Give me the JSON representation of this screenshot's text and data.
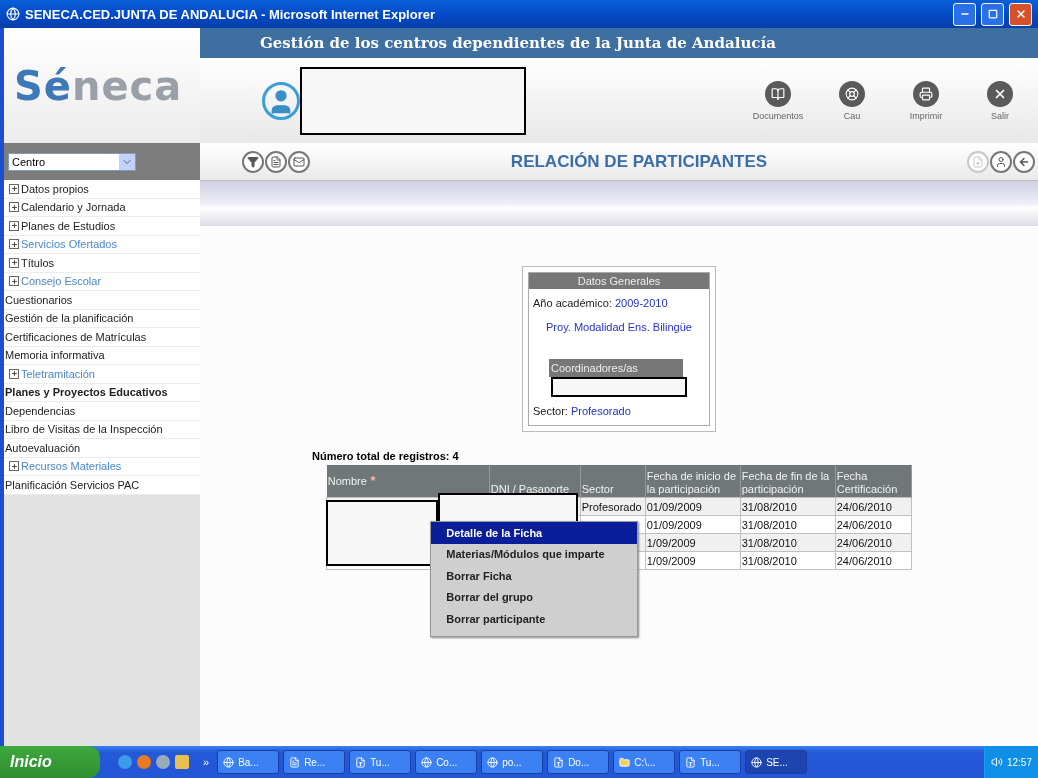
{
  "window": {
    "title": "SENECA.CED.JUNTA DE ANDALUCIA - Microsoft Internet Explorer"
  },
  "header": {
    "logo": "Séneca",
    "banner": "Gestión de los centros dependientes de la Junta de Andalucía",
    "actions": [
      {
        "kind": "docs",
        "label": "Documentos"
      },
      {
        "kind": "help",
        "label": "Cau"
      },
      {
        "kind": "print",
        "label": "Imprimir"
      },
      {
        "kind": "exit",
        "label": "Salir"
      }
    ]
  },
  "sidebar": {
    "select": "Centro",
    "items": [
      {
        "kind": "group",
        "label": "Datos propios",
        "highlighted": false
      },
      {
        "kind": "group",
        "label": "Calendario y Jornada",
        "highlighted": false
      },
      {
        "kind": "group",
        "label": "Planes de Estudios",
        "highlighted": false
      },
      {
        "kind": "group",
        "label": "Servicios Ofertados",
        "highlighted": true
      },
      {
        "kind": "group",
        "label": "Títulos",
        "highlighted": false
      },
      {
        "kind": "group",
        "label": "Consejo Escolar",
        "highlighted": true
      },
      {
        "kind": "item",
        "label": "Cuestionarios",
        "highlighted": false
      },
      {
        "kind": "item",
        "label": "Gestión de la planificación",
        "highlighted": false
      },
      {
        "kind": "item",
        "label": "Certificaciones de Matrículas",
        "highlighted": false
      },
      {
        "kind": "item",
        "label": "Memoria informativa",
        "highlighted": false
      },
      {
        "kind": "group",
        "label": "Teletramitación",
        "highlighted": true
      },
      {
        "kind": "heading",
        "label": "Planes y Proyectos Educativos",
        "highlighted": false
      },
      {
        "kind": "item",
        "label": "Dependencias",
        "highlighted": false
      },
      {
        "kind": "item",
        "label": "Libro de Visitas de la Inspección",
        "highlighted": false
      },
      {
        "kind": "item",
        "label": "Autoevaluación",
        "highlighted": false
      },
      {
        "kind": "group",
        "label": "Recursos Materiales",
        "highlighted": true
      },
      {
        "kind": "item",
        "label": "Planificación Servicios PAC",
        "highlighted": false
      }
    ]
  },
  "page": {
    "title": "RELACIÓN DE PARTICIPANTES",
    "tools_left": [
      {
        "kind": "filter"
      },
      {
        "kind": "export"
      },
      {
        "kind": "mail"
      }
    ],
    "tools_right": [
      {
        "kind": "new",
        "disabled": true
      },
      {
        "kind": "person",
        "disabled": false
      },
      {
        "kind": "back",
        "disabled": false
      }
    ]
  },
  "card": {
    "title": "Datos Generales",
    "year_label": "Año académico:",
    "year": "2009-2010",
    "project": "Proy. Modalidad Ens. Bilingüe",
    "coordinators_title": "Coordinadores/as",
    "sector_label": "Sector:",
    "sector": "Profesorado"
  },
  "table": {
    "count": "Número total de registros: 4",
    "columns": [
      "Nombre",
      "DNI / Pasaporte",
      "Sector",
      "Fecha de inicio de la participación",
      "Fecha de fin de la participación",
      "Fecha Certificación"
    ],
    "required_mark": "*",
    "rows": [
      [
        "",
        "",
        "Profesorado",
        "01/09/2009",
        "31/08/2010",
        "24/06/2010"
      ],
      [
        "",
        "",
        "",
        "01/09/2009",
        "31/08/2010",
        "24/06/2010"
      ],
      [
        "",
        "",
        "",
        "1/09/2009",
        "31/08/2010",
        "24/06/2010"
      ],
      [
        "",
        "",
        "",
        "1/09/2009",
        "31/08/2010",
        "24/06/2010"
      ]
    ]
  },
  "context_menu": [
    {
      "label": "Detalle de la Ficha",
      "selected": true
    },
    {
      "label": "Materias/Módulos que imparte",
      "selected": false
    },
    {
      "label": "Borrar Ficha",
      "selected": false
    },
    {
      "label": "Borrar del grupo",
      "selected": false
    },
    {
      "label": "Borrar participante",
      "selected": false
    }
  ],
  "taskbar": {
    "start": "Inicio",
    "chevron": "»",
    "tasks": [
      {
        "kind": "ie",
        "label": "Ba...",
        "selected": false
      },
      {
        "kind": "doc",
        "label": "Re...",
        "selected": false
      },
      {
        "kind": "word",
        "label": "Tu...",
        "selected": false
      },
      {
        "kind": "ie",
        "label": "Co...",
        "selected": false
      },
      {
        "kind": "ie",
        "label": "po...",
        "selected": false
      },
      {
        "kind": "word",
        "label": "Do...",
        "selected": false
      },
      {
        "kind": "folder",
        "label": "C:\\...",
        "selected": false
      },
      {
        "kind": "word",
        "label": "Tu...",
        "selected": false
      },
      {
        "kind": "ie",
        "label": "SE...",
        "selected": true
      }
    ],
    "clock": "12:57"
  }
}
